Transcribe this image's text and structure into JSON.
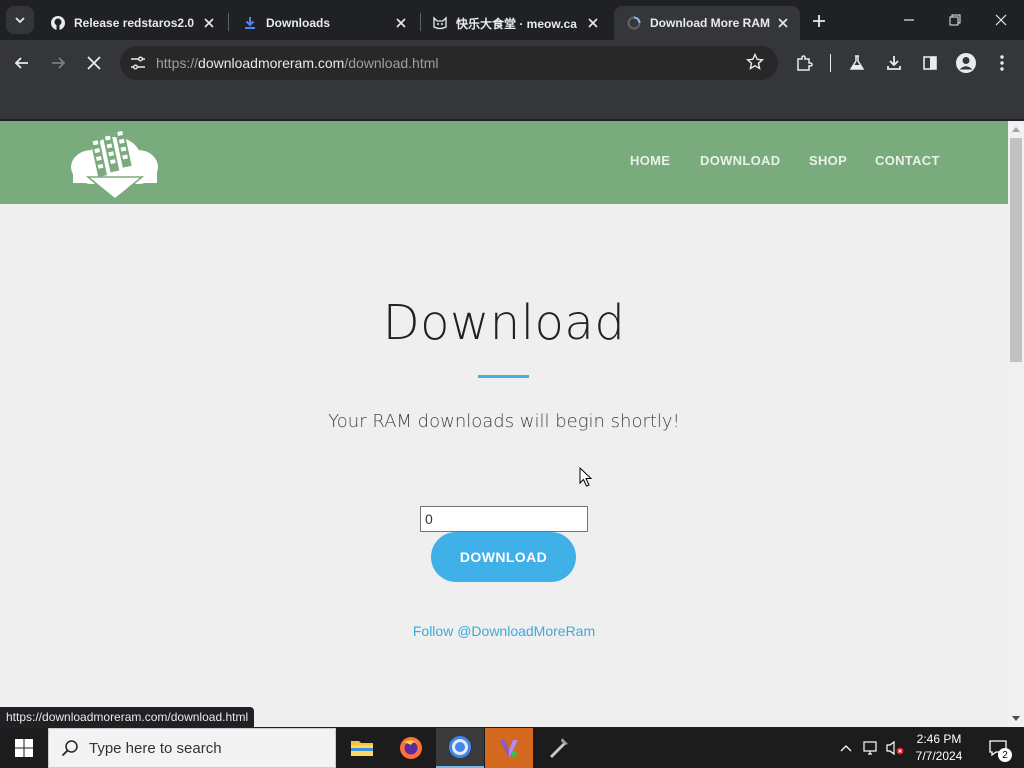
{
  "browser": {
    "tabs": [
      {
        "title": "Release redstaros2.0 ·",
        "icon": "github-icon"
      },
      {
        "title": "Downloads",
        "icon": "download-icon"
      },
      {
        "title": "快乐大食堂 · meow.ca",
        "icon": "cat-icon"
      },
      {
        "title": "Download More RAM",
        "icon": "loading-icon"
      }
    ],
    "active_tab": 3,
    "url_prefix": "https://",
    "url_host": "downloadmoreram.com",
    "url_path": "/download.html",
    "status_url": "https://downloadmoreram.com/download.html"
  },
  "site": {
    "nav": [
      "HOME",
      "DOWNLOAD",
      "SHOP",
      "CONTACT"
    ],
    "title": "Download",
    "subtitle": "Your RAM downloads will begin shortly!",
    "amount_value": "0",
    "download_button": "DOWNLOAD",
    "follow_link": "Follow @DownloadMoreRam",
    "colors": {
      "header": "#79ab7c",
      "accent": "#3fb1dd",
      "button": "#3fb1e8"
    }
  },
  "taskbar": {
    "search_placeholder": "Type here to search",
    "time": "2:46 PM",
    "date": "7/7/2024",
    "notification_count": "2",
    "apps": [
      "file-explorer-icon",
      "firefox-icon",
      "chrome-icon",
      "visual-studio-icon",
      "app-icon"
    ]
  }
}
